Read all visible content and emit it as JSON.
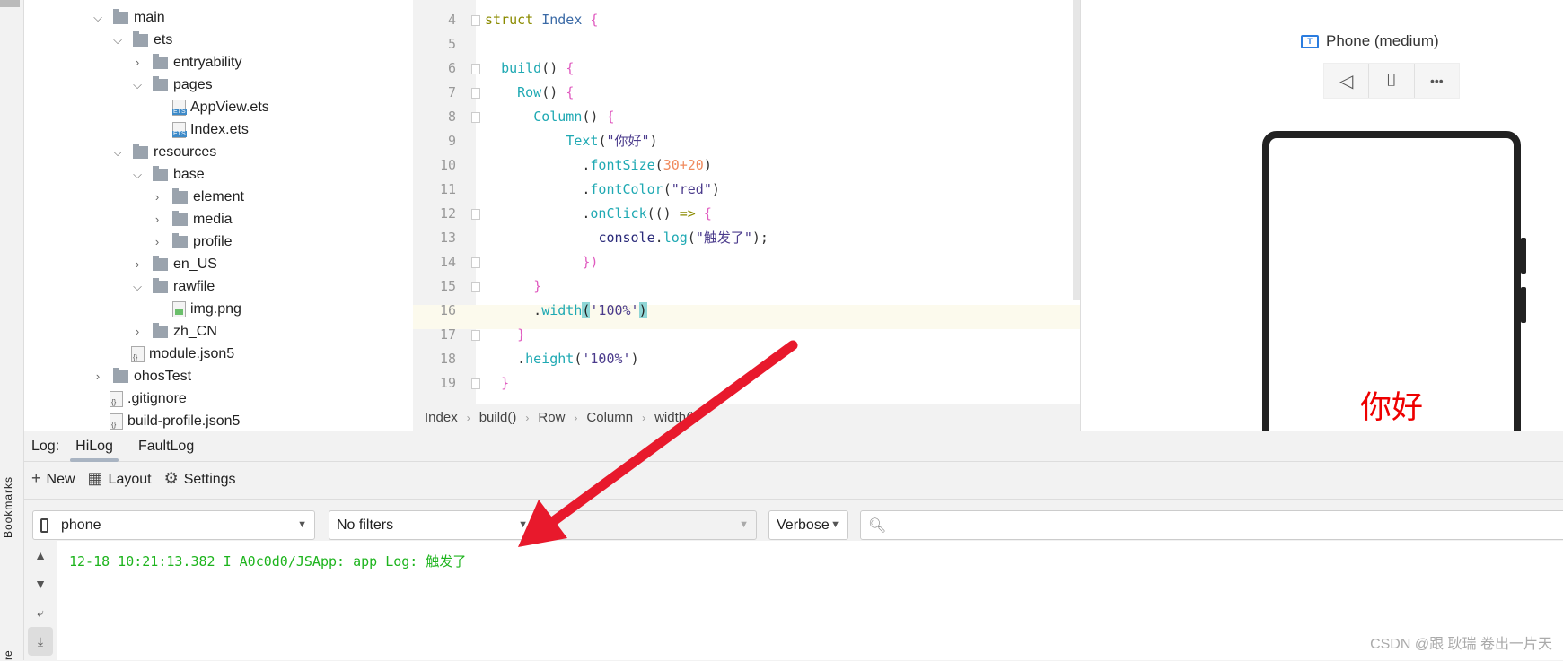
{
  "sidebar": {
    "bookmarks_label": "Bookmarks",
    "structure_label": "re"
  },
  "tree": [
    {
      "label": "main",
      "depth": 0,
      "type": "folder",
      "expanded": true
    },
    {
      "label": "ets",
      "depth": 1,
      "type": "folder",
      "expanded": true
    },
    {
      "label": "entryability",
      "depth": 2,
      "type": "folder",
      "expanded": false
    },
    {
      "label": "pages",
      "depth": 2,
      "type": "folder",
      "expanded": true
    },
    {
      "label": "AppView.ets",
      "depth": 3,
      "type": "ets"
    },
    {
      "label": "Index.ets",
      "depth": 3,
      "type": "ets"
    },
    {
      "label": "resources",
      "depth": 1,
      "type": "folder",
      "expanded": true
    },
    {
      "label": "base",
      "depth": 2,
      "type": "folder",
      "expanded": true
    },
    {
      "label": "element",
      "depth": 3,
      "type": "folder",
      "expanded": false
    },
    {
      "label": "media",
      "depth": 3,
      "type": "folder",
      "expanded": false
    },
    {
      "label": "profile",
      "depth": 3,
      "type": "folder",
      "expanded": false
    },
    {
      "label": "en_US",
      "depth": 2,
      "type": "folder",
      "expanded": false
    },
    {
      "label": "rawfile",
      "depth": 2,
      "type": "folder",
      "expanded": true
    },
    {
      "label": "img.png",
      "depth": 3,
      "type": "img"
    },
    {
      "label": "zh_CN",
      "depth": 2,
      "type": "folder",
      "expanded": false
    },
    {
      "label": "module.json5",
      "depth": 2,
      "type": "json",
      "nochev": true
    },
    {
      "label": "ohosTest",
      "depth": 0,
      "type": "folder",
      "expanded": false
    },
    {
      "label": ".gitignore",
      "depth": -1,
      "type": "json"
    },
    {
      "label": "build-profile.json5",
      "depth": -1,
      "type": "json"
    }
  ],
  "editor": {
    "current_line": "16",
    "lines": [
      {
        "n": "4",
        "tokens": [
          [
            "kw",
            "struct "
          ],
          [
            "id",
            "Index "
          ],
          [
            "br",
            "{"
          ]
        ]
      },
      {
        "n": "5",
        "tokens": []
      },
      {
        "n": "6",
        "tokens": [
          [
            "pl",
            "  "
          ],
          [
            "fn",
            "build"
          ],
          [
            "pl",
            "() "
          ],
          [
            "br",
            "{"
          ]
        ]
      },
      {
        "n": "7",
        "tokens": [
          [
            "pl",
            "    "
          ],
          [
            "fn",
            "Row"
          ],
          [
            "pl",
            "() "
          ],
          [
            "br",
            "{"
          ]
        ]
      },
      {
        "n": "8",
        "tokens": [
          [
            "pl",
            "      "
          ],
          [
            "fn",
            "Column"
          ],
          [
            "pl",
            "() "
          ],
          [
            "br",
            "{"
          ]
        ]
      },
      {
        "n": "9",
        "tokens": [
          [
            "pl",
            "          "
          ],
          [
            "fn",
            "Text"
          ],
          [
            "pl",
            "("
          ],
          [
            "str",
            "\"你好\""
          ],
          [
            "pl",
            ")"
          ]
        ]
      },
      {
        "n": "10",
        "tokens": [
          [
            "pl",
            "            ."
          ],
          [
            "fn",
            "fontSize"
          ],
          [
            "pl",
            "("
          ],
          [
            "num",
            "30+20"
          ],
          [
            "pl",
            ")"
          ]
        ]
      },
      {
        "n": "11",
        "tokens": [
          [
            "pl",
            "            ."
          ],
          [
            "fn",
            "fontColor"
          ],
          [
            "pl",
            "("
          ],
          [
            "str",
            "\"red\""
          ],
          [
            "pl",
            ")"
          ]
        ]
      },
      {
        "n": "12",
        "tokens": [
          [
            "pl",
            "            ."
          ],
          [
            "fn",
            "onClick"
          ],
          [
            "pl",
            "(() "
          ],
          [
            "kw",
            "=>"
          ],
          [
            "pl",
            " "
          ],
          [
            "br",
            "{"
          ]
        ]
      },
      {
        "n": "13",
        "tokens": [
          [
            "pl",
            "              "
          ],
          [
            "dk",
            "console"
          ],
          [
            "pl",
            "."
          ],
          [
            "fn",
            "log"
          ],
          [
            "pl",
            "("
          ],
          [
            "str",
            "\"触发了\""
          ],
          [
            "pl",
            ");"
          ]
        ]
      },
      {
        "n": "14",
        "tokens": [
          [
            "pl",
            "            "
          ],
          [
            "br",
            "})"
          ]
        ]
      },
      {
        "n": "15",
        "tokens": [
          [
            "pl",
            "      "
          ],
          [
            "br",
            "}"
          ]
        ]
      },
      {
        "n": "16",
        "tokens": [
          [
            "pl",
            "      ."
          ],
          [
            "fn",
            "width"
          ],
          [
            "hl",
            "("
          ],
          [
            "str",
            "'100%'"
          ],
          [
            "hl",
            ")"
          ]
        ]
      },
      {
        "n": "17",
        "tokens": [
          [
            "pl",
            "    "
          ],
          [
            "br",
            "}"
          ]
        ]
      },
      {
        "n": "18",
        "tokens": [
          [
            "pl",
            "    ."
          ],
          [
            "fn",
            "height"
          ],
          [
            "pl",
            "("
          ],
          [
            "str",
            "'100%'"
          ],
          [
            "pl",
            ")"
          ]
        ]
      },
      {
        "n": "19",
        "tokens": [
          [
            "pl",
            "  "
          ],
          [
            "br",
            "}"
          ]
        ]
      }
    ]
  },
  "breadcrumb": [
    "Index",
    "build()",
    "Row",
    "Column",
    "width()"
  ],
  "preview": {
    "device": "Phone (medium)",
    "device_icon": "T",
    "toolbar": [
      "◁",
      "⌷",
      "•••"
    ],
    "hello_text": "你好"
  },
  "log": {
    "label": "Log:",
    "tabs": [
      "HiLog",
      "FaultLog"
    ],
    "active_tab": "HiLog",
    "toolbar": {
      "new": "New",
      "layout": "Layout",
      "settings": "Settings"
    },
    "device": "phone",
    "filter": "No filters",
    "process": "",
    "level": "Verbose",
    "search_placeholder": "",
    "line": "12-18 10:21:13.382 I A0c0d0/JSApp: app Log: 触发了",
    "line_color": "#1db41d"
  },
  "watermark": "CSDN @跟 耿瑞 卷出一片天",
  "annotation_arrow_color": "#e8192c"
}
